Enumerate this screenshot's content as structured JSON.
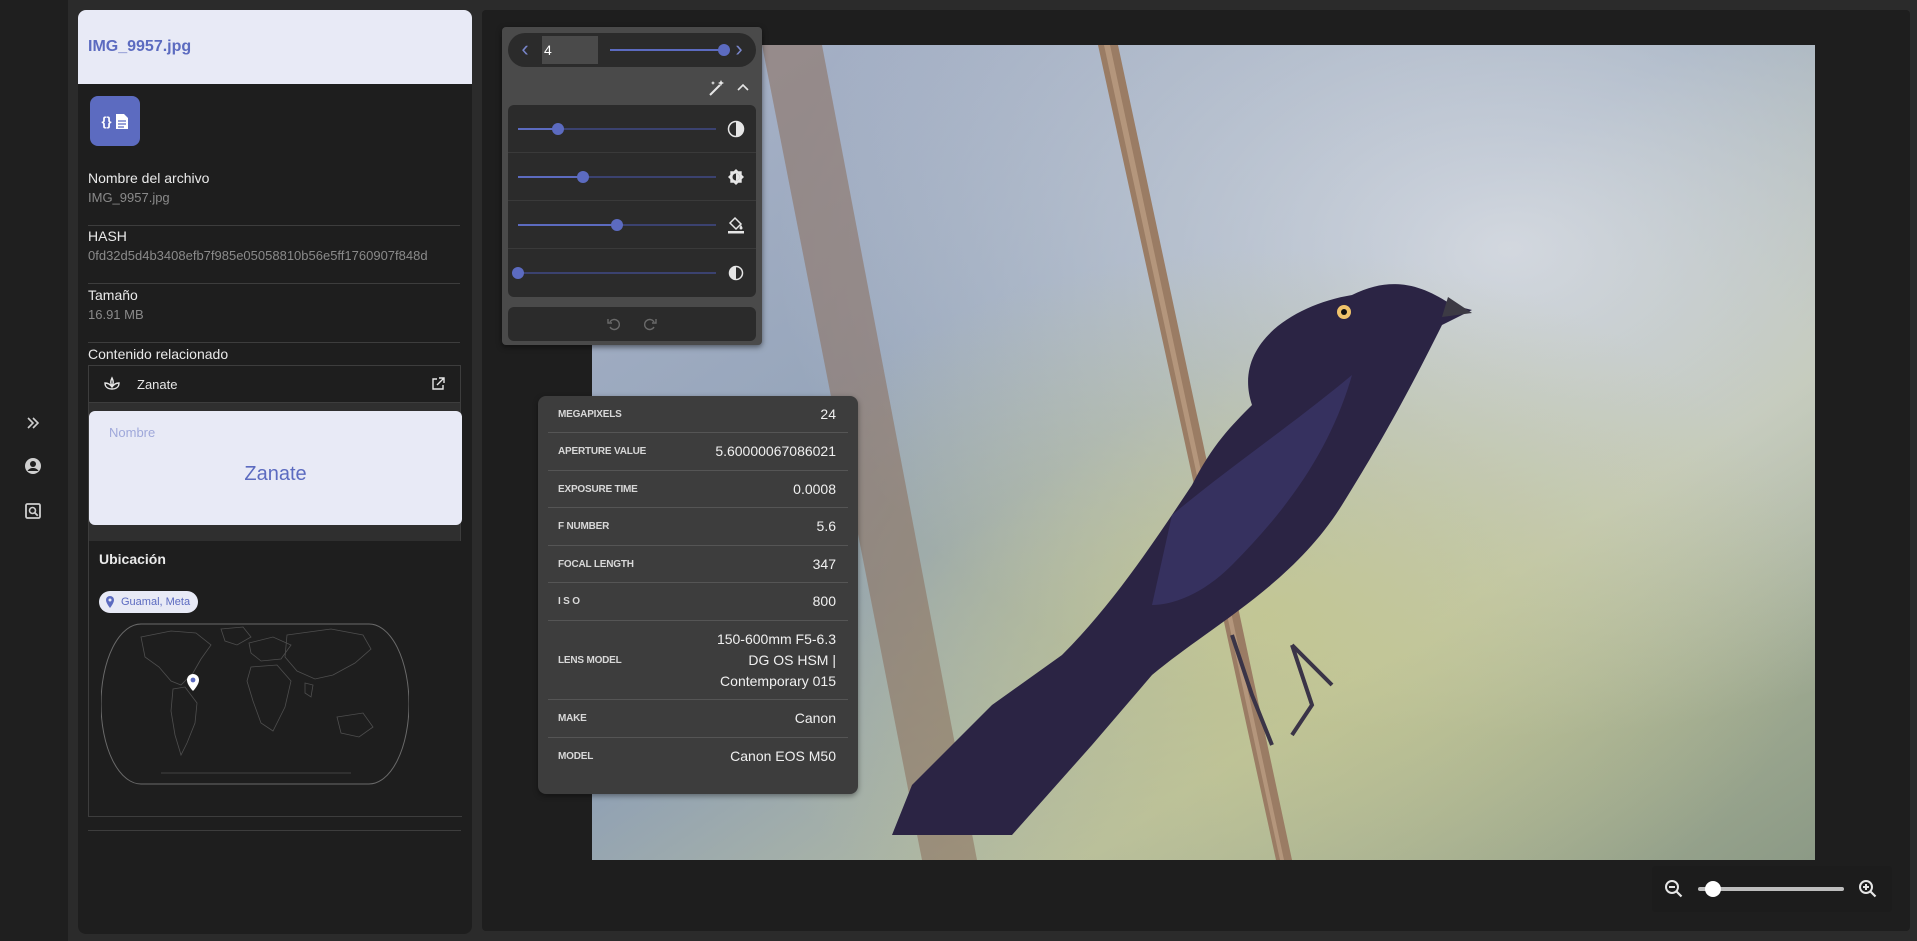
{
  "file": {
    "title": "IMG_9957.jpg"
  },
  "meta": {
    "filename_label": "Nombre del archivo",
    "filename_value": "IMG_9957.jpg",
    "hash_label": "HASH",
    "hash_value": "0fd32d5d4b3408efb7f985e05058810b56e5ff1760907f848d",
    "size_label": "Tamaño",
    "size_value": "16.91 MB"
  },
  "related": {
    "title": "Contenido relacionado",
    "item_label": "Zanate",
    "name_label": "Nombre",
    "name_value": "Zanate",
    "location_title": "Ubicación",
    "location_chip": "Guamal, Meta"
  },
  "nav": {
    "current_index": "4"
  },
  "adjustments": {
    "contrast": 0.2,
    "brightness": 0.33,
    "saturation": 0.5,
    "invert": 0.0
  },
  "exif": [
    {
      "label": "MEGAPIXELS",
      "value": "24"
    },
    {
      "label": "APERTURE VALUE",
      "value": "5.60000067086021"
    },
    {
      "label": "EXPOSURE TIME",
      "value": "0.0008"
    },
    {
      "label": "F NUMBER",
      "value": "5.6"
    },
    {
      "label": "FOCAL LENGTH",
      "value": "347"
    },
    {
      "label": "I S O",
      "value": "800"
    },
    {
      "label": "LENS MODEL",
      "value": "150-600mm F5-6.3 DG OS HSM | Contemporary 015"
    },
    {
      "label": "MAKE",
      "value": "Canon"
    },
    {
      "label": "MODEL",
      "value": "Canon EOS M50"
    }
  ],
  "zoom": {
    "level": 0.1
  },
  "colors": {
    "accent": "#5c6bc0",
    "accent_light": "#e8eaf6"
  }
}
